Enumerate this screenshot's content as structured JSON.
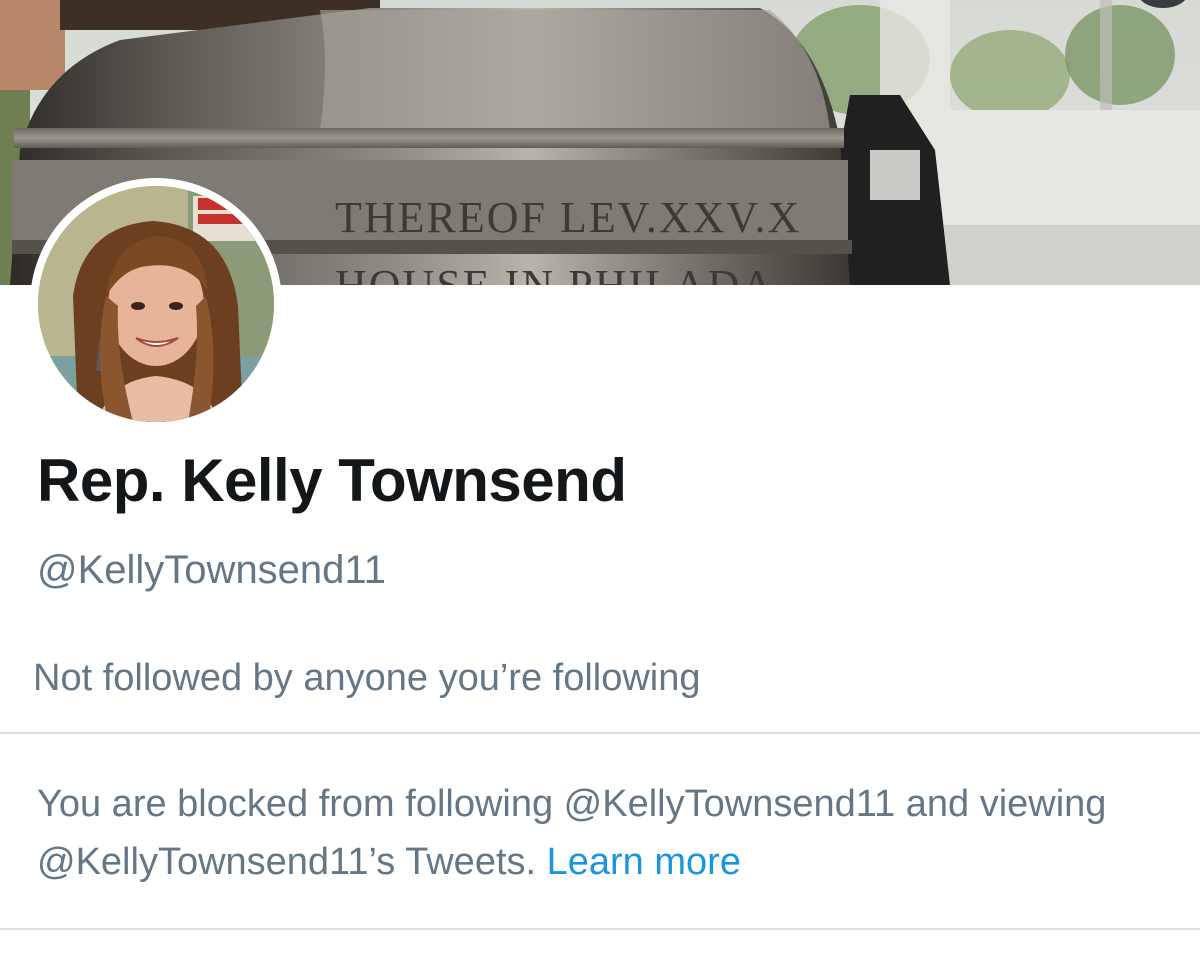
{
  "profile": {
    "display_name": "Rep. Kelly Townsend",
    "handle": "@KellyTownsend11",
    "followed_by": "Not followed by anyone you’re following"
  },
  "blocked": {
    "text_part1": "You are blocked from following @KellyTownsend11 and viewing @KellyTownsend11’s Tweets. ",
    "learn_more": "Learn more"
  },
  "banner": {
    "engraving_main": "THEREOF LEV.XXV.X",
    "engraving_lower": "HOUSE IN PHILADA"
  },
  "colors": {
    "name": "#14171a",
    "secondary_text": "#657786",
    "link": "#1b95e0",
    "divider": "#dbe0e4"
  }
}
